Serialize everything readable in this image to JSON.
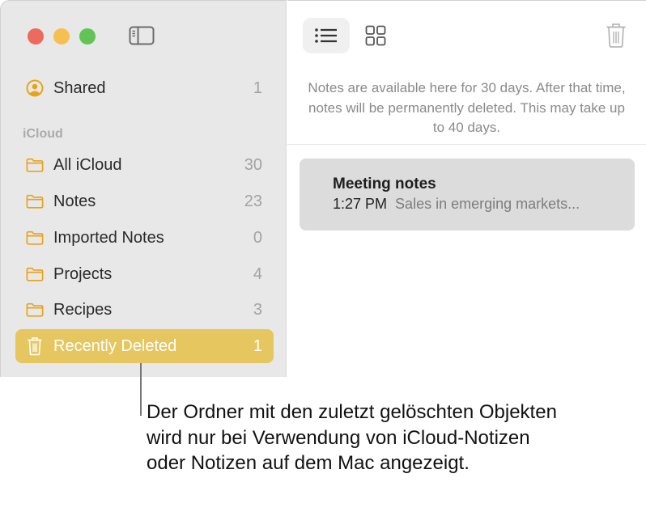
{
  "window": {
    "controls": {
      "close": "close-window",
      "minimize": "minimize-window",
      "zoom": "zoom-window"
    },
    "sidebar_toggle_icon": "sidebar-toggle-icon"
  },
  "sidebar": {
    "shared": {
      "label": "Shared",
      "count": "1",
      "icon": "person-circle-icon"
    },
    "section_header": "iCloud",
    "folders": [
      {
        "label": "All iCloud",
        "count": "30",
        "icon": "folder-icon"
      },
      {
        "label": "Notes",
        "count": "23",
        "icon": "folder-icon"
      },
      {
        "label": "Imported Notes",
        "count": "0",
        "icon": "folder-icon"
      },
      {
        "label": "Projects",
        "count": "4",
        "icon": "folder-icon"
      },
      {
        "label": "Recipes",
        "count": "3",
        "icon": "folder-icon"
      },
      {
        "label": "Recently Deleted",
        "count": "1",
        "icon": "trash-icon",
        "selected": true
      }
    ],
    "accent_color": "#e6c65e",
    "icon_color": "#e8a317"
  },
  "toolbar": {
    "list_view_icon": "list-view-icon",
    "gallery_view_icon": "gallery-view-icon",
    "delete_icon": "trash-icon"
  },
  "content": {
    "info_text": "Notes are available here for 30 days. After that time, notes will be permanently deleted. This may take up to 40 days.",
    "notes": [
      {
        "title": "Meeting notes",
        "time": "1:27 PM",
        "snippet": "Sales in emerging markets..."
      }
    ]
  },
  "callout": {
    "text": "Der Ordner mit den zuletzt gelöschten Objekten wird nur bei Verwendung von iCloud-Notizen oder Notizen auf dem Mac angezeigt."
  }
}
